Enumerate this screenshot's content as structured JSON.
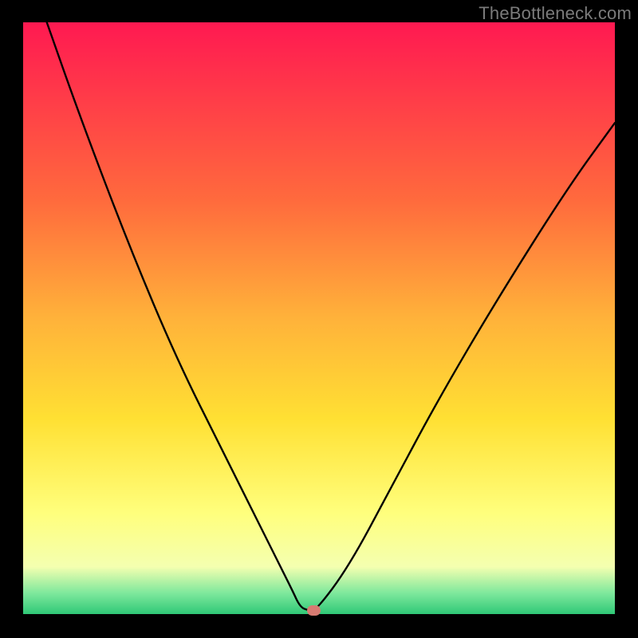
{
  "watermark": "TheBottleneck.com",
  "chart_data": {
    "type": "line",
    "title": "",
    "xlabel": "",
    "ylabel": "",
    "xlim": [
      0,
      100
    ],
    "ylim": [
      0,
      100
    ],
    "series": [
      {
        "name": "curve",
        "x": [
          4,
          10,
          18,
          26,
          34,
          40,
          43,
          45.5,
          46.8,
          48.2,
          49.5,
          55,
          62,
          70,
          80,
          92,
          100
        ],
        "y": [
          100,
          83,
          62,
          43,
          27,
          15,
          9,
          4,
          1.2,
          0.6,
          0.6,
          8,
          21,
          36,
          53,
          72,
          83
        ]
      }
    ],
    "marker": {
      "x": 49,
      "y": 0.6
    },
    "background_gradient": {
      "stops": [
        {
          "pos": 0.0,
          "color": "#ff1951"
        },
        {
          "pos": 0.3,
          "color": "#ff6a3d"
        },
        {
          "pos": 0.5,
          "color": "#ffb23a"
        },
        {
          "pos": 0.67,
          "color": "#ffe033"
        },
        {
          "pos": 0.83,
          "color": "#ffff7d"
        },
        {
          "pos": 0.92,
          "color": "#f4ffb0"
        },
        {
          "pos": 0.965,
          "color": "#7de89c"
        },
        {
          "pos": 1.0,
          "color": "#2fc877"
        }
      ]
    }
  }
}
